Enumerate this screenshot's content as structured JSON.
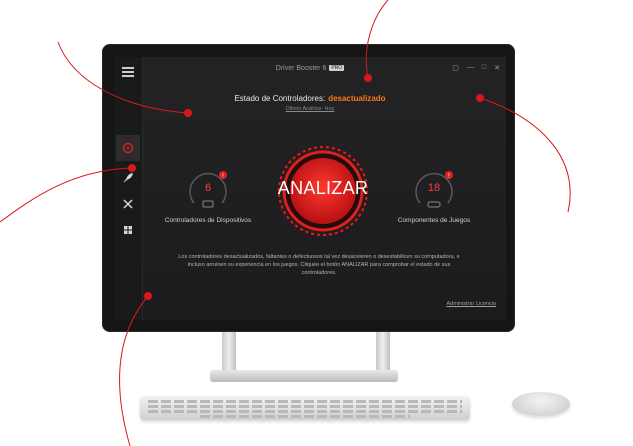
{
  "app": {
    "title": "Driver Booster 6",
    "badge": "PRO"
  },
  "status": {
    "label": "Estado de Controladores:",
    "value": "desactualizado",
    "last_scan": "Último Análisis: Hoy"
  },
  "gauges": {
    "devices": {
      "count": "6",
      "label": "Controladores de Dispositivos"
    },
    "games": {
      "count": "18",
      "label": "Componentes de Juegos"
    }
  },
  "scan_button": {
    "label": "ANALIZAR"
  },
  "description": "Los controladores desactualizados, faltantes o defectuosos tal vez desaceleren o desestabilicen su computadora, e incluso arruinen su experiencia en los juegos. Cliquée el botón ANALIZAR para comprobar el estado de sus controladores.",
  "license_link": "Administrar Licencia",
  "colors": {
    "accent": "#e0201f",
    "status_warning": "#ff7a1a",
    "background": "#1f1f21"
  },
  "sidebar": {
    "items": [
      {
        "icon": "scan-icon",
        "active": true
      },
      {
        "icon": "rocket-icon",
        "active": false
      },
      {
        "icon": "tools-icon",
        "active": false
      },
      {
        "icon": "grid-icon",
        "active": false
      }
    ]
  }
}
